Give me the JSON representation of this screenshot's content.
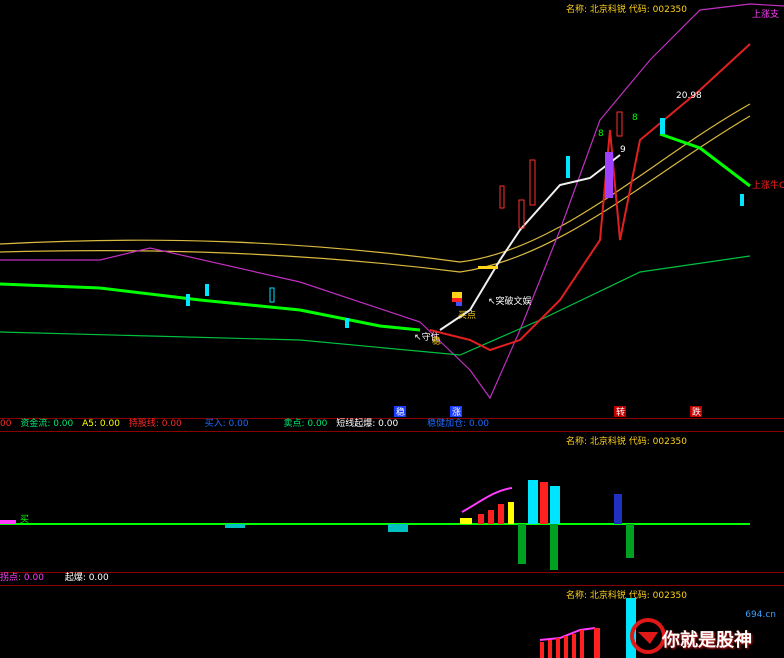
{
  "stock": {
    "header": "名称: 北京科锐 代码: 002350",
    "header2": "名称: 北京科锐 代码: 002350",
    "header3": "名称: 北京科锐 代码: 002350"
  },
  "main_annotations": {
    "top_right_label": "上涨支",
    "right_label": "上涨牛C",
    "peak_price": "20.98",
    "marker_8_a": "8",
    "marker_8_b": "8",
    "marker_9": "9",
    "break_label": "↖突破文娱",
    "buy_point": "买点",
    "low_label": "↖守住",
    "low_label2": "稳",
    "bottom_tag1": "稳",
    "bottom_tag2": "涨",
    "bottom_tag3": "转",
    "bottom_tag4": "跌"
  },
  "indicator_bar_1": {
    "items": [
      {
        "label": "00",
        "color": "#ff2a2a"
      },
      {
        "label": "资金流: 0.00",
        "color": "#00e676"
      },
      {
        "label": "A5: 0.00",
        "color": "#ffff00"
      },
      {
        "label": "持股线: 0.00",
        "color": "#ff2a2a"
      },
      {
        "label": "买入: 0.00",
        "color": "#1e6bff"
      },
      {
        "label": "卖点: 0.00",
        "color": "#00e676"
      },
      {
        "label": "短线起爆: 0.00",
        "color": "#ffffff"
      },
      {
        "label": "稳健加仓: 0.00",
        "color": "#1e6bff"
      }
    ]
  },
  "indicator_bar_2": {
    "items": [
      {
        "label": "拐点: 0.00",
        "color": "#ff3cff"
      },
      {
        "label": "起爆: 0.00",
        "color": "#ffffff"
      }
    ]
  },
  "mid_annotations": {
    "left_mark": "买"
  },
  "watermark": {
    "site": "694.cn",
    "text": "你就是股神"
  },
  "colors": {
    "background": "#000000",
    "up_candle": "#ff3030",
    "down_candle": "#00e5ff",
    "ma_green": "#00ff00",
    "band_yellow": "#e6c840",
    "band_magenta": "#c030c0",
    "separator": "#8a0000"
  }
}
